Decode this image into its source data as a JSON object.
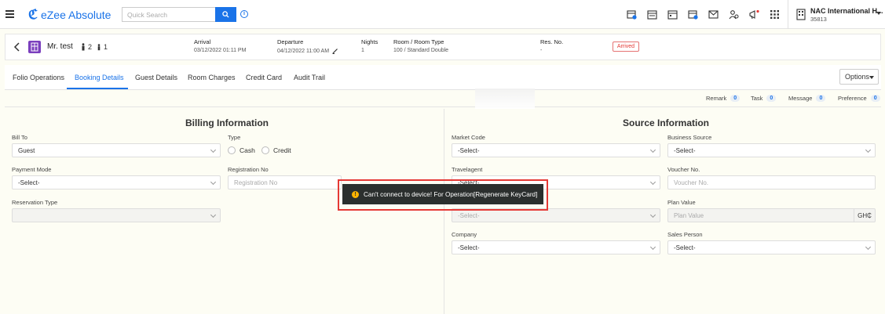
{
  "app": {
    "name": "eZee Absolute"
  },
  "search": {
    "placeholder": "Quick Search"
  },
  "hotel": {
    "name": "NAC International H...",
    "code": "35813"
  },
  "booking": {
    "guest_name": "Mr. test",
    "adults": "2",
    "children": "1",
    "arrival_label": "Arrival",
    "arrival_value": "03/12/2022 01:11 PM",
    "departure_label": "Departure",
    "departure_value": "04/12/2022 11:00 AM",
    "nights_label": "Nights",
    "nights_value": "1",
    "room_label": "Room / Room Type",
    "room_value": "100 / Standard Double",
    "res_label": "Res. No.",
    "res_value": "-",
    "status": "Arrived"
  },
  "tabs": [
    {
      "label": "Folio Operations"
    },
    {
      "label": "Booking Details"
    },
    {
      "label": "Guest Details"
    },
    {
      "label": "Room Charges"
    },
    {
      "label": "Credit Card"
    },
    {
      "label": "Audit Trail"
    }
  ],
  "options_label": "Options",
  "counters": [
    {
      "label": "Remark",
      "count": "0"
    },
    {
      "label": "Task",
      "count": "0"
    },
    {
      "label": "Message",
      "count": "0"
    },
    {
      "label": "Preference",
      "count": "0"
    }
  ],
  "billing": {
    "title": "Billing Information",
    "bill_to_label": "Bill To",
    "bill_to_value": "Guest",
    "type_label": "Type",
    "type_cash": "Cash",
    "type_credit": "Credit",
    "payment_mode_label": "Payment Mode",
    "payment_mode_value": "-Select-",
    "registration_label": "Registration No",
    "registration_placeholder": "Registration No",
    "reservation_type_label": "Reservation Type",
    "reservation_type_value": ""
  },
  "source": {
    "title": "Source Information",
    "market_code_label": "Market Code",
    "market_code_value": "-Select-",
    "business_source_label": "Business Source",
    "business_source_value": "-Select-",
    "travelagent_label": "Travelagent",
    "travelagent_value": "-Select-",
    "voucher_label": "Voucher No.",
    "voucher_placeholder": "Voucher No.",
    "commission_value": "-Select-",
    "plan_value_label": "Plan Value",
    "plan_value_placeholder": "Plan Value",
    "currency": "GH₵",
    "company_label": "Company",
    "company_value": "-Select-",
    "sales_person_label": "Sales Person",
    "sales_person_value": "-Select-"
  },
  "toast": {
    "message": "Can't connect to device! For Operation[Regenerate KeyCard]"
  },
  "colors": {
    "accent": "#1a73e8",
    "error": "#e53935",
    "room_icon": "#7b3fbe",
    "toast_bg": "#2b2f2e",
    "warning": "#ffb300"
  },
  "icons": [
    "menu-icon",
    "search-icon",
    "info-icon",
    "calendar-add-icon",
    "calendar-icon",
    "calendar-grid-icon",
    "calendar-dollar-icon",
    "mail-icon",
    "users-gear-icon",
    "megaphone-icon",
    "apps-grid-icon",
    "building-icon",
    "back-arrow-icon",
    "room-icon",
    "adult-icon",
    "child-icon",
    "edit-icon",
    "warning-icon"
  ]
}
